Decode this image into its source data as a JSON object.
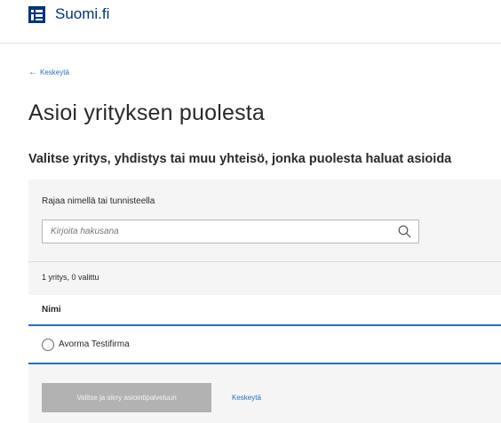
{
  "header": {
    "logo_text": "Suomi.fi"
  },
  "back_link": {
    "label": "Keskeytä",
    "icon": "arrow-left-icon"
  },
  "page": {
    "title": "Asioi yrityksen puolesta",
    "subtitle": "Valitse yritys, yhdistys tai muu yhteisö, jonka puolesta haluat asioida"
  },
  "filter": {
    "label": "Rajaa nimellä tai tunnisteella",
    "placeholder": "Kirjoita hakusana",
    "value": "",
    "icon": "search-icon"
  },
  "results": {
    "count_text": "1 yritys, 0 valittu",
    "column_header": "Nimi",
    "rows": [
      {
        "name": "Avorma Testifirma",
        "selected": false
      }
    ]
  },
  "actions": {
    "primary_label": "Valitse ja siirry asiointipalveluun",
    "primary_disabled": true,
    "cancel_label": "Keskeytä"
  },
  "colors": {
    "brand": "#003479",
    "link": "#2a6ebb",
    "disabled_button": "#b2b2b2",
    "panel_bg": "#f5f5f5"
  }
}
